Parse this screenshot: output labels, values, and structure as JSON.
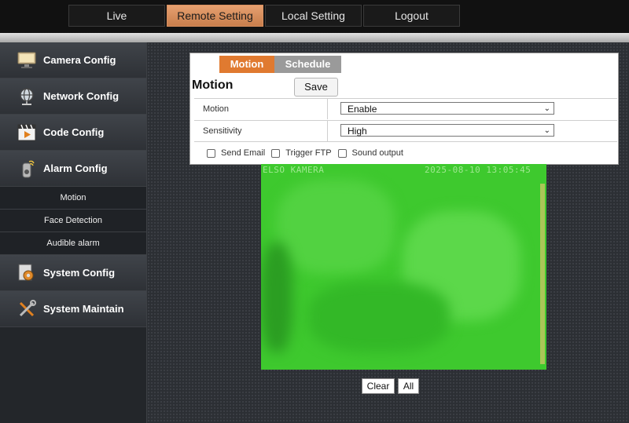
{
  "topnav": {
    "tabs": [
      {
        "label": "Live",
        "active": false
      },
      {
        "label": "Remote Setting",
        "active": true
      },
      {
        "label": "Local Setting",
        "active": false
      },
      {
        "label": "Logout",
        "active": false
      }
    ]
  },
  "sidebar": {
    "camera_config": {
      "label": "Camera Config",
      "icon": "monitor-icon"
    },
    "network_config": {
      "label": "Network Config",
      "icon": "globe-icon"
    },
    "code_config": {
      "label": "Code Config",
      "icon": "film-play-icon"
    },
    "alarm_config": {
      "label": "Alarm Config",
      "icon": "alarm-icon"
    },
    "alarm_sub": [
      "Motion",
      "Face Detection",
      "Audible alarm"
    ],
    "system_config": {
      "label": "System Config",
      "icon": "gear-icon"
    },
    "system_maintain": {
      "label": "System Maintain",
      "icon": "tools-icon"
    }
  },
  "panel": {
    "tabs": {
      "motion": "Motion",
      "schedule": "Schedule"
    },
    "title": "Motion",
    "save_label": "Save",
    "rows": {
      "motion": {
        "label": "Motion",
        "value": "Enable"
      },
      "sensitivity": {
        "label": "Sensitivity",
        "value": "High"
      }
    },
    "checks": {
      "email": "Send Email",
      "ftp": "Trigger FTP",
      "sound": "Sound output"
    }
  },
  "camera": {
    "osd_name": "ELSO KAMERA",
    "osd_time": "2025-08-10 13:05:45"
  },
  "buttons": {
    "clear": "Clear",
    "all": "All"
  },
  "colors": {
    "accent": "#e07a30",
    "active_tab": "#d3895a",
    "feed_green": "#3ec92e"
  }
}
